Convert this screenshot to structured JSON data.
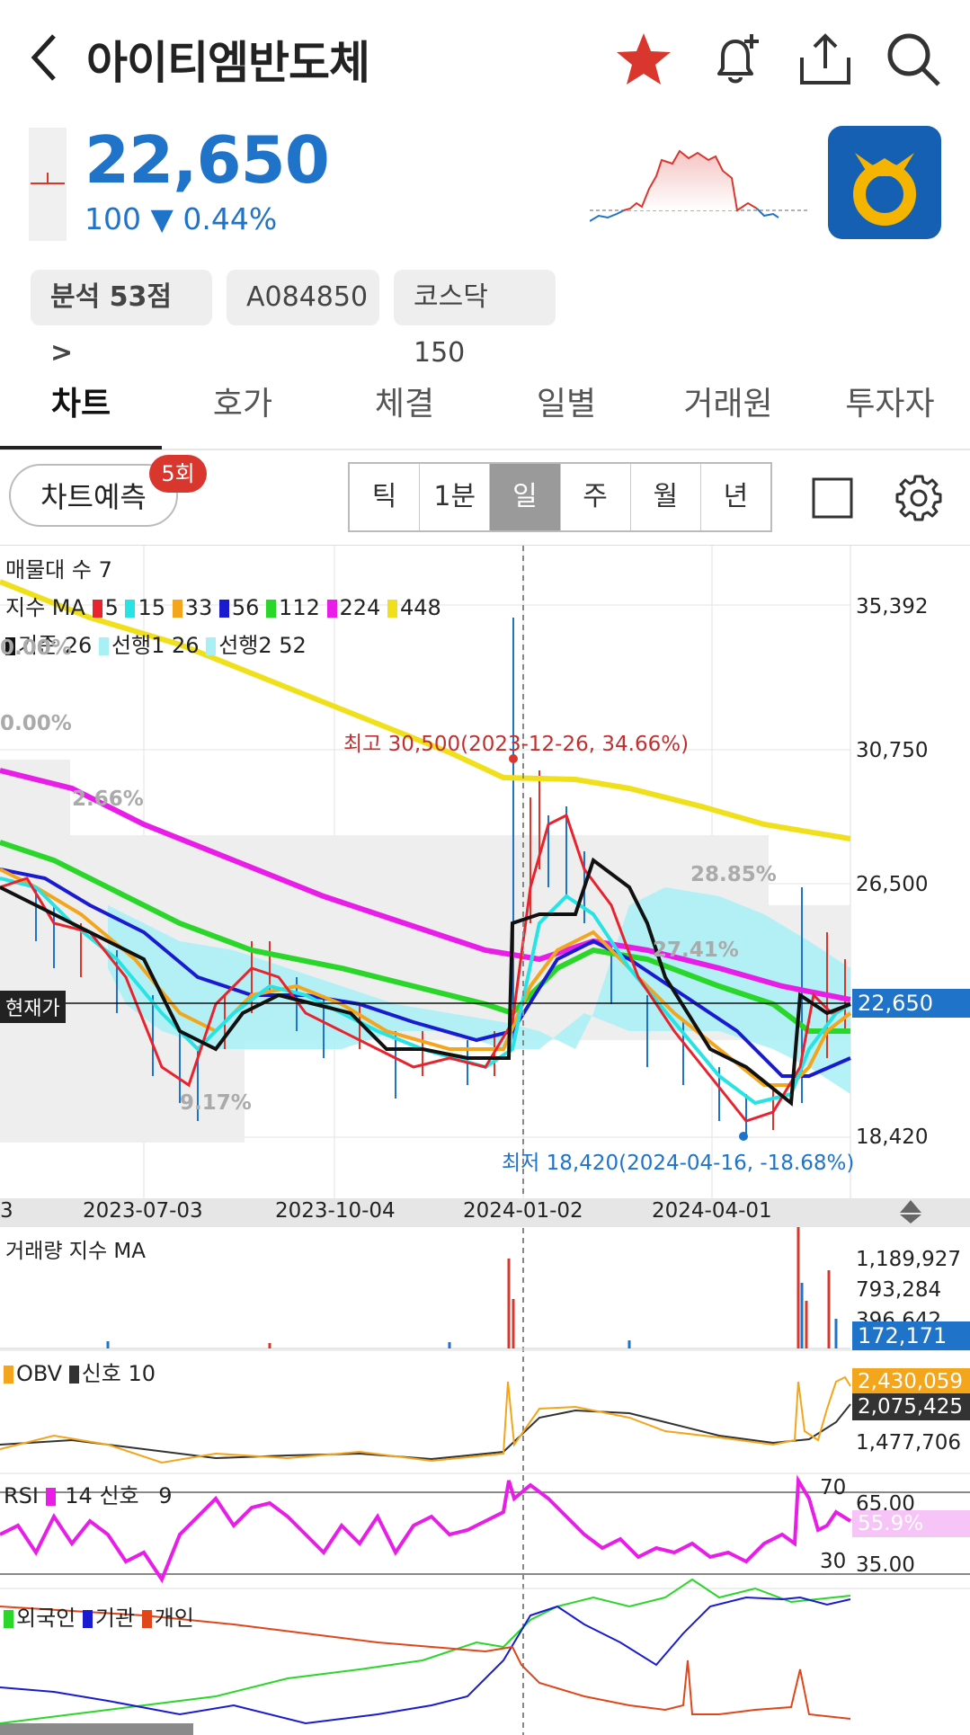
{
  "header": {
    "title": "아이티엠반도체"
  },
  "quote": {
    "price": "22,650",
    "change_value": "100",
    "change_pct": "▼ 0.44%"
  },
  "chips": [
    "분석 53점 >",
    "A084850",
    "코스닥150"
  ],
  "tabs": [
    "차트",
    "호가",
    "체결",
    "일별",
    "거래원",
    "투자자"
  ],
  "toolbar": {
    "predict_label": "차트예측",
    "predict_badge": "5회",
    "periods": [
      "틱",
      "1분",
      "일",
      "주",
      "월",
      "년"
    ],
    "selected_period": "일"
  },
  "chart_data": [
    {
      "type": "line",
      "name_label": "매물대 수 7",
      "ma_label": "지수 MA",
      "ma_series": [
        {
          "name": "5",
          "color": "#e8232d"
        },
        {
          "name": "15",
          "color": "#28e3e3"
        },
        {
          "name": "33",
          "color": "#f3a51b"
        },
        {
          "name": "56",
          "color": "#1a1ad1"
        },
        {
          "name": "112",
          "color": "#2bd62b"
        },
        {
          "name": "224",
          "color": "#e81ee8"
        },
        {
          "name": "448",
          "color": "#f0e01c"
        }
      ],
      "ichimoku_series": [
        {
          "name": "기준 26",
          "color": "#111111"
        },
        {
          "name": "선행1 26",
          "color": "#a8f0f6"
        },
        {
          "name": "선행2 52",
          "color": "#a8f0f6"
        }
      ],
      "y_ticks": [
        "35,392",
        "30,750",
        "26,500",
        "22,650",
        "18,420"
      ],
      "current_price_label": "현재가",
      "current_price": "22,650",
      "high_annotation": "최고 30,500(2023-12-26, 34.66%)",
      "low_annotation": "최저 18,420(2024-04-16, -18.68%)",
      "volume_profile_labels": [
        "0.00%",
        "0.00%",
        "2.66%",
        "28.85%",
        "27.41%",
        "9.17%"
      ],
      "x_ticks": [
        "3",
        "2023-07-03",
        "2023-10-04",
        "2024-01-02",
        "2024-04-01"
      ],
      "close_approx": [
        {
          "x": "2023-05",
          "y": 26200
        },
        {
          "x": "2023-06",
          "y": 24300
        },
        {
          "x": "2023-07-03",
          "y": 22000
        },
        {
          "x": "2023-08",
          "y": 22600
        },
        {
          "x": "2023-09",
          "y": 22100
        },
        {
          "x": "2023-10-04",
          "y": 21700
        },
        {
          "x": "2023-11",
          "y": 21400
        },
        {
          "x": "2023-12-26",
          "y": 30500
        },
        {
          "x": "2024-01-02",
          "y": 28000
        },
        {
          "x": "2024-02",
          "y": 24200
        },
        {
          "x": "2024-03",
          "y": 21300
        },
        {
          "x": "2024-04-16",
          "y": 18420
        },
        {
          "x": "2024-05",
          "y": 22650
        }
      ]
    },
    {
      "type": "bar",
      "title": "거래량 지수 MA",
      "y_ticks": [
        "1,189,927",
        "793,284",
        "396,642"
      ],
      "current": "172,171"
    },
    {
      "type": "line",
      "series": [
        {
          "name": "OBV",
          "color": "#f3a51b"
        },
        {
          "name": "신호 10",
          "color": "#333333"
        }
      ],
      "y_ticks": [
        "2,430,059",
        "2,075,425",
        "1,477,706"
      ]
    },
    {
      "type": "line",
      "series": [
        {
          "name": "RSI",
          "color": "#e81ee8"
        },
        {
          "name": "14 신호",
          "color": "#cccccc"
        }
      ],
      "extra_label": "9",
      "levels": [
        "70",
        "30"
      ],
      "y_ticks": [
        "65.00",
        "55.9%",
        "35.00"
      ]
    },
    {
      "type": "line",
      "series": [
        {
          "name": "외국인",
          "color": "#2bd62b"
        },
        {
          "name": "기관",
          "color": "#1a1ad1"
        },
        {
          "name": "개인",
          "color": "#e0461a"
        }
      ]
    }
  ]
}
